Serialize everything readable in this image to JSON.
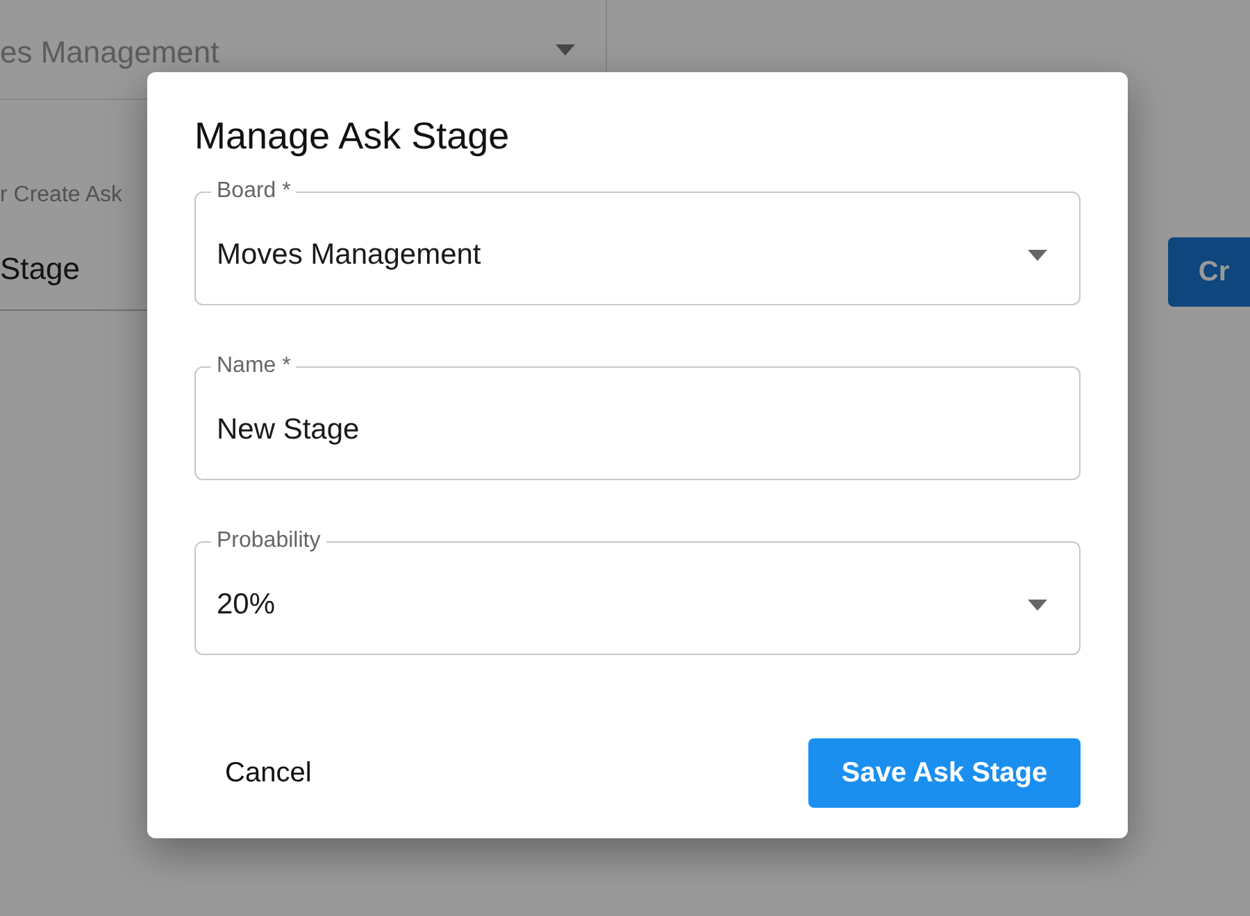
{
  "background_page": {
    "board_select": {
      "value": "es Management",
      "disabled": true
    },
    "name_field": {
      "label": "r Create Ask",
      "value": "Stage"
    },
    "create_button": {
      "label": "Cr"
    }
  },
  "dialog": {
    "title": "Manage Ask Stage",
    "fields": [
      {
        "kind": "select",
        "label": "Board *",
        "value": "Moves Management"
      },
      {
        "kind": "text",
        "label": "Name *",
        "value": "New Stage"
      },
      {
        "kind": "select",
        "label": "Probability",
        "value": "20%"
      }
    ],
    "buttons": [
      {
        "kind": "text",
        "label": "Cancel"
      },
      {
        "kind": "contained",
        "label": "Save Ask Stage"
      }
    ]
  }
}
